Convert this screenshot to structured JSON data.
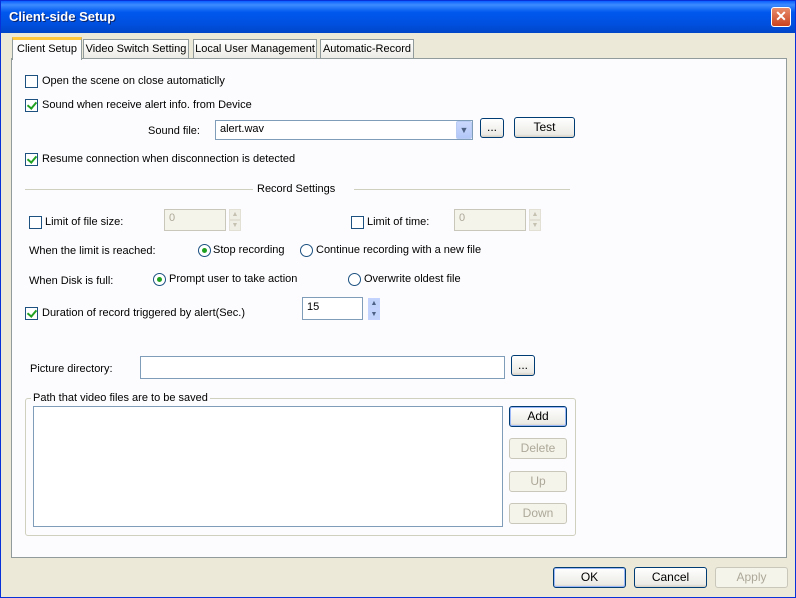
{
  "window": {
    "title": "Client-side Setup"
  },
  "tabs": [
    {
      "label": "Client Setup",
      "active": true
    },
    {
      "label": "Video Switch Setting",
      "active": false
    },
    {
      "label": "Local User Management",
      "active": false
    },
    {
      "label": "Automatic-Record",
      "active": false
    }
  ],
  "client_setup": {
    "open_scene_on_close": {
      "label": "Open the scene on close automaticlly",
      "checked": false
    },
    "sound_alert": {
      "label": "Sound when receive alert info. from Device",
      "checked": true
    },
    "sound_file": {
      "label": "Sound file:",
      "value": "alert.wav",
      "browse_label": "...",
      "test_label": "Test"
    },
    "resume_connection": {
      "label": "Resume connection when disconnection is detected",
      "checked": true
    },
    "record_settings": {
      "heading": "Record Settings",
      "limit_file_size": {
        "label": "Limit of file size:",
        "checked": false,
        "value": "0"
      },
      "limit_time": {
        "label": "Limit of time:",
        "checked": false,
        "value": "0"
      },
      "when_limit": {
        "label": "When the limit is reached:",
        "options": [
          "Stop recording",
          "Continue recording with a new file"
        ],
        "selected": "Stop recording"
      },
      "when_disk_full": {
        "label": "When Disk is full:",
        "options": [
          "Prompt user to take action",
          "Overwrite oldest file"
        ],
        "selected": "Prompt user to take action"
      },
      "alert_duration": {
        "label": "Duration of record triggered by alert(Sec.)",
        "checked": true,
        "value": "15"
      }
    },
    "picture_directory": {
      "label": "Picture directory:",
      "value": "",
      "browse_label": "..."
    },
    "video_paths": {
      "label": "Path that video files are to be saved",
      "items": [],
      "buttons": {
        "add": "Add",
        "delete": "Delete",
        "up": "Up",
        "down": "Down"
      }
    }
  },
  "footer": {
    "ok": "OK",
    "cancel": "Cancel",
    "apply": "Apply"
  },
  "colors": {
    "titlebar": "#0058EE",
    "dialog_bg": "#ECE9D8",
    "panel_bg": "#FCFCFE",
    "check": "#21A121",
    "active_tab_accent": "#FFC83C"
  }
}
